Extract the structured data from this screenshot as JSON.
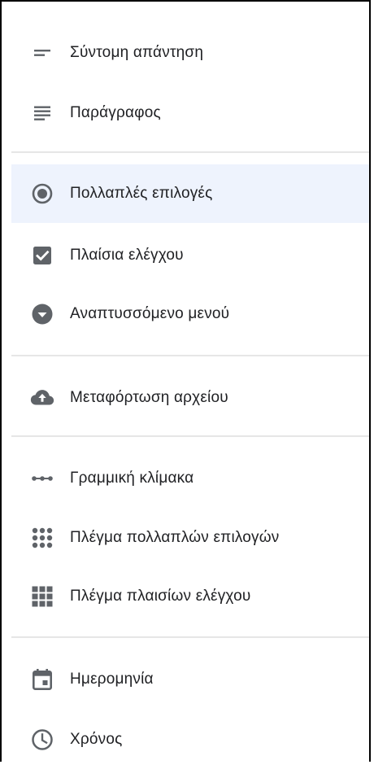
{
  "menu": {
    "items": [
      {
        "label": "Σύντομη απάντηση",
        "icon": "short-text-icon"
      },
      {
        "label": "Παράγραφος",
        "icon": "paragraph-icon"
      },
      {
        "label": "Πολλαπλές επιλογές",
        "icon": "radio-button-icon",
        "selected": true
      },
      {
        "label": "Πλαίσια ελέγχου",
        "icon": "checkbox-icon"
      },
      {
        "label": "Αναπτυσσόμενο μενού",
        "icon": "dropdown-icon"
      },
      {
        "label": "Μεταφόρτωση αρχείου",
        "icon": "cloud-upload-icon"
      },
      {
        "label": "Γραμμική κλίμακα",
        "icon": "linear-scale-icon"
      },
      {
        "label": "Πλέγμα πολλαπλών επιλογών",
        "icon": "multiple-choice-grid-icon"
      },
      {
        "label": "Πλέγμα πλαισίων ελέγχου",
        "icon": "checkbox-grid-icon"
      },
      {
        "label": "Ημερομηνία",
        "icon": "calendar-icon"
      },
      {
        "label": "Χρόνος",
        "icon": "clock-icon"
      }
    ]
  },
  "colors": {
    "icon": "#5f6368",
    "text": "#202124",
    "selected_background": "#eef3fd",
    "divider": "#e6e6e6"
  }
}
